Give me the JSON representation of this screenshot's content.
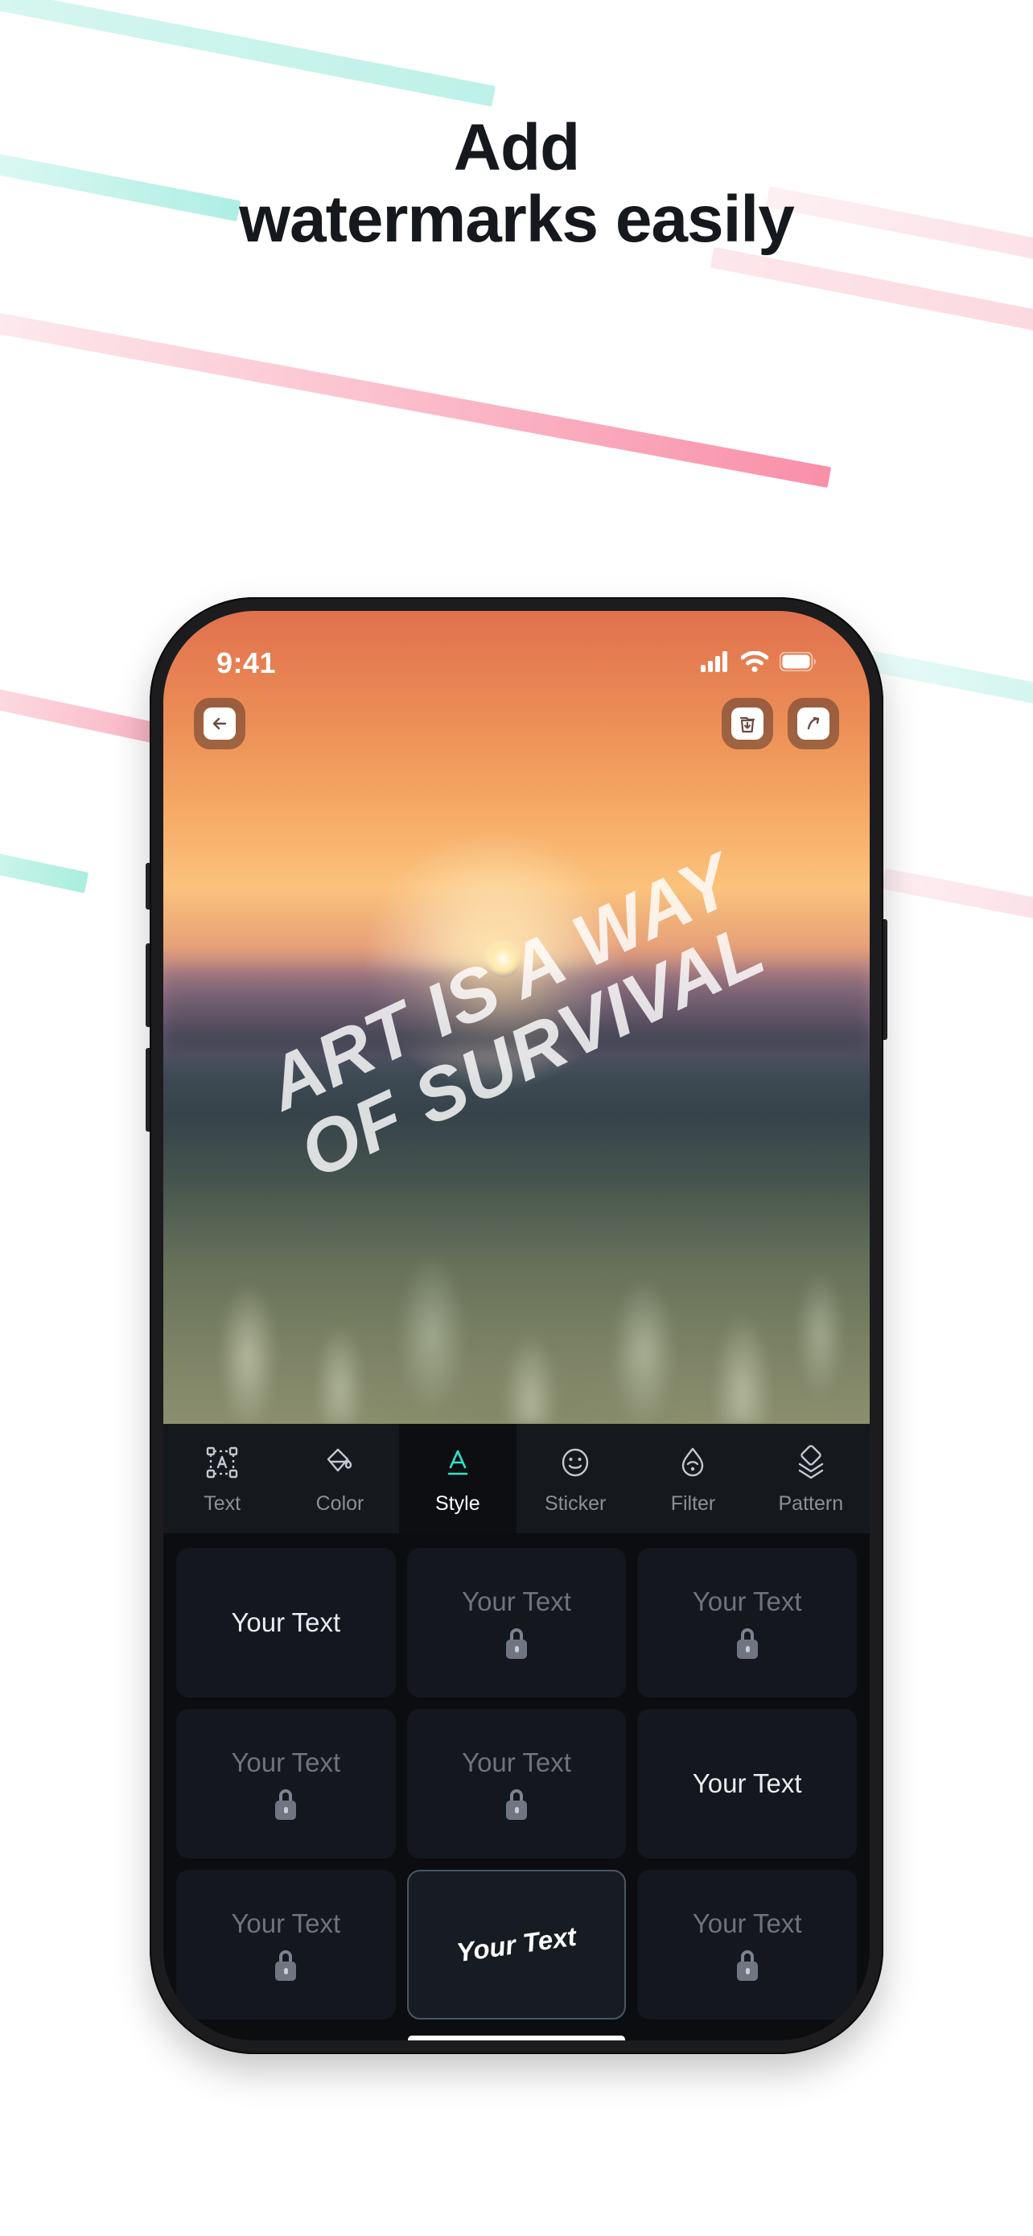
{
  "promo": {
    "headline_line1": "Add",
    "headline_line2": "watermarks easily"
  },
  "phone": {
    "status_bar": {
      "time": "9:41",
      "cellular_icon": "cellular-signal-icon",
      "wifi_icon": "wifi-icon",
      "battery_icon": "battery-icon"
    },
    "toolbar": {
      "back_label": "←",
      "back_icon": "back-arrow-icon",
      "save_icon": "save-download-icon",
      "share_icon": "share-arrow-icon"
    },
    "canvas": {
      "watermark_line1": "ART IS A WAY",
      "watermark_line2": "OF SURVIVAL"
    },
    "tabs": [
      {
        "label": "Text",
        "icon": "text-frame-icon",
        "active": false
      },
      {
        "label": "Color",
        "icon": "paint-drop-icon",
        "active": false
      },
      {
        "label": "Style",
        "icon": "letter-a-icon",
        "active": true
      },
      {
        "label": "Sticker",
        "icon": "smiley-face-icon",
        "active": false
      },
      {
        "label": "Filter",
        "icon": "filter-drop-icon",
        "active": false
      },
      {
        "label": "Pattern",
        "icon": "layers-icon",
        "active": false
      }
    ],
    "style_grid": [
      {
        "label": "Your Text",
        "locked": false,
        "selected": false
      },
      {
        "label": "Your Text",
        "locked": true,
        "selected": false
      },
      {
        "label": "Your Text",
        "locked": true,
        "selected": false
      },
      {
        "label": "Your Text",
        "locked": true,
        "selected": false
      },
      {
        "label": "Your Text",
        "locked": true,
        "selected": false
      },
      {
        "label": "Your Text",
        "locked": false,
        "selected": false
      },
      {
        "label": "Your Text",
        "locked": true,
        "selected": false
      },
      {
        "label": "Your Text",
        "locked": false,
        "selected": true
      },
      {
        "label": "Your Text",
        "locked": true,
        "selected": false
      }
    ]
  },
  "colors": {
    "accent_cyan": "#2ee6c8",
    "mint_ribbon": "#bdf1e7",
    "pink_ribbon": "#f98fa8",
    "headline": "#15181c",
    "screen_bg": "#0b0d10",
    "tabbar_bg": "#15181d"
  }
}
